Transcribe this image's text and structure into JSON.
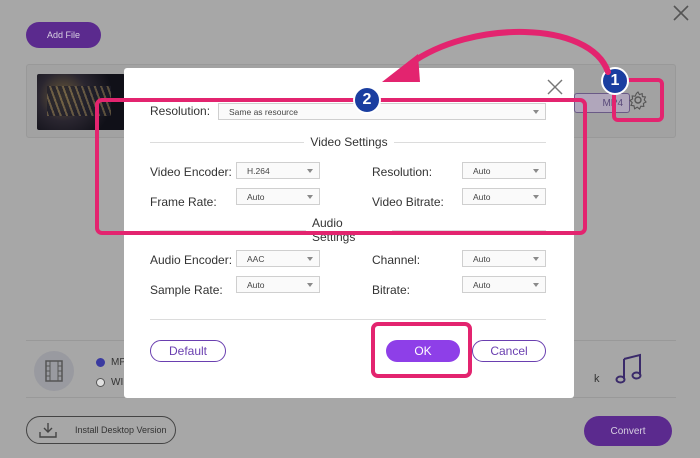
{
  "app": {
    "add_file_label": "Add File",
    "format_label": "MP4",
    "radio_items": [
      "MP",
      "WI"
    ],
    "trailing_text": "k",
    "install_label": "Install Desktop Version",
    "convert_label": "Convert"
  },
  "dialog": {
    "resolution_top_label": "Resolution:",
    "resolution_top_value": "Same as resource",
    "video_section_title": "Video Settings",
    "video": {
      "encoder_label": "Video Encoder:",
      "encoder_value": "H.264",
      "frame_rate_label": "Frame Rate:",
      "frame_rate_value": "Auto",
      "resolution_label": "Resolution:",
      "resolution_value": "Auto",
      "bitrate_label": "Video Bitrate:",
      "bitrate_value": "Auto"
    },
    "audio_section_title": "Audio Settings",
    "audio": {
      "encoder_label": "Audio Encoder:",
      "encoder_value": "AAC",
      "sample_rate_label": "Sample Rate:",
      "sample_rate_value": "Auto",
      "channel_label": "Channel:",
      "channel_value": "Auto",
      "bitrate_label": "Bitrate:",
      "bitrate_value": "Auto"
    },
    "default_label": "Default",
    "ok_label": "OK",
    "cancel_label": "Cancel"
  },
  "annotations": {
    "step1": "1",
    "step2": "2",
    "highlight_color": "#e3246f",
    "arrow_color": "#e3246f",
    "badge_color": "#1a3ea0"
  },
  "colors": {
    "accent": "#8e3fe8",
    "accent_dark": "#5b2a8e"
  }
}
